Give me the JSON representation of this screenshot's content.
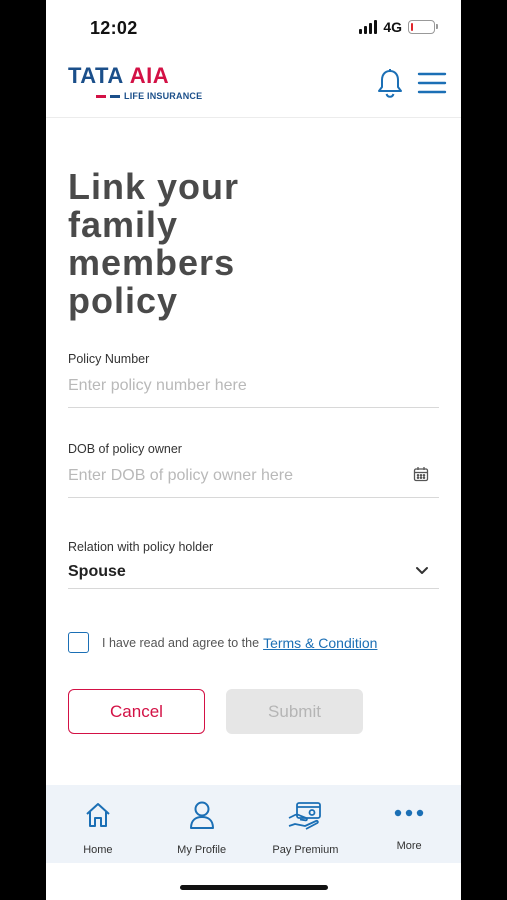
{
  "status_bar": {
    "time": "12:02",
    "network": "4G",
    "battery_level": 0.1,
    "battery_color": "#e0262b"
  },
  "header": {
    "logo_brand": "TATA",
    "logo_accent": "AIA",
    "logo_subtitle": "LIFE INSURANCE",
    "brand_blue": "#1b4f8a",
    "brand_red": "#d31145",
    "icons": [
      "bell-icon",
      "hamburger-menu-icon"
    ]
  },
  "page": {
    "title": "Link your family members policy"
  },
  "form": {
    "policy_number": {
      "label": "Policy Number",
      "placeholder": "Enter policy number here",
      "value": ""
    },
    "dob": {
      "label": "DOB of policy owner",
      "placeholder": "Enter DOB of policy owner here",
      "value": "",
      "icon": "calendar-icon"
    },
    "relation": {
      "label": "Relation with policy holder",
      "selected": "Spouse",
      "icon": "chevron-down-icon"
    },
    "terms": {
      "text": "I have read and agree to the",
      "link": "Terms & Condition",
      "checked": false
    },
    "buttons": {
      "cancel": "Cancel",
      "submit": "Submit",
      "submit_enabled": false
    }
  },
  "bottom_nav": {
    "items": [
      {
        "label": "Home",
        "icon": "home-icon"
      },
      {
        "label": "My Profile",
        "icon": "profile-icon"
      },
      {
        "label": "Pay Premium",
        "icon": "pay-premium-icon"
      },
      {
        "label": "More",
        "icon": "more-dots-icon"
      }
    ],
    "icon_color": "#1b6fb5"
  }
}
